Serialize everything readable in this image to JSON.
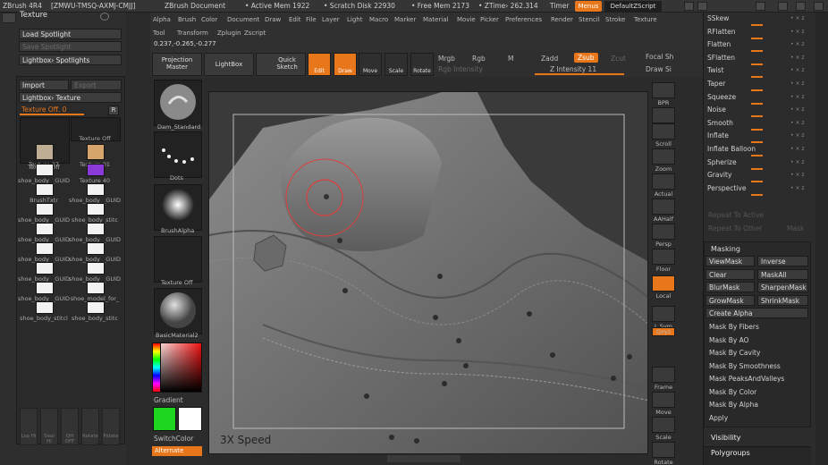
{
  "titlebar": {
    "app": "ZBrush 4R4",
    "id": "[ZMWU-TMSQ-AXMJ-CMJJ]",
    "doc": "ZBrush Document",
    "active_mem": "• Active Mem 1922",
    "scratch": "• Scratch Disk 22930",
    "free_mem": "• Free Mem 2173",
    "ztime": "• ZTime› 262.314",
    "timer": "Timer",
    "menus": "Menus",
    "default_script": "DefaultZScript"
  },
  "menubar": [
    "Alpha",
    "Brush",
    "Color",
    "Document",
    "Draw",
    "Edit",
    "File",
    "Layer",
    "Light",
    "Macro",
    "Marker",
    "Material",
    "Movie",
    "Picker",
    "Preferences",
    "Render",
    "Stencil",
    "Stroke",
    "Texture"
  ],
  "menubar2": [
    "Tool",
    "Transform",
    "Zplugin",
    "Zscript"
  ],
  "coords": "0.237,-0.265,-0.277",
  "shelf": {
    "projection_master": "Projection Master",
    "lightbox": "LightBox",
    "quick_sketch": "Quick Sketch",
    "edit": "Edit",
    "draw": "Draw",
    "move": "Move",
    "scale": "Scale",
    "rotate": "Rotate",
    "mrgb": "Mrgb",
    "rgb": "Rgb",
    "m": "M",
    "rgb_intensity": "Rgb Intensity",
    "zadd": "Zadd",
    "zsub": "Zsub",
    "zcut": "Zcut",
    "z_intensity": "Z Intensity 11",
    "focal_shift": "Focal Sh",
    "draw_size": "Draw Si"
  },
  "left": {
    "panel_title": "Texture",
    "load_spotlight": "Load Spotlight",
    "save_spotlight": "Save Spotlight",
    "lightbox_spotlights": "Lightbox› Spotlights",
    "import": "Import",
    "export": "Export",
    "lightbox_texture": "Lightbox› Texture",
    "texture_off": "Texture Off. 0",
    "r": "R",
    "thumbs": [
      [
        "Texture Off",
        "Texture Off"
      ],
      [
        "Texture 27",
        "Texture 01"
      ],
      [
        "shoe_body__GUID",
        "Texture 40"
      ],
      [
        "BrushTxtr",
        "shoe_body__GUID"
      ],
      [
        "shoe_body__GUID",
        "shoe_body_stitc"
      ],
      [
        "shoe_body__GUID",
        "shoe_body__GUID"
      ],
      [
        "shoe_body__GUID",
        "shoe_body__GUID"
      ],
      [
        "shoe_body__GUID",
        "shoe_body__GUID"
      ],
      [
        "shoe_body__GUID",
        "shoe_model_for_"
      ],
      [
        "shoe_body_stitcl",
        "shoe_body_stitc"
      ]
    ],
    "bottom_icons": [
      "Lsp Hi",
      "Seal Hi",
      "QH OFF",
      "Rotate",
      "Pstate"
    ]
  },
  "vcol": {
    "brush": "Dam_Standard",
    "stroke": "Dots",
    "alpha": "BrushAlpha",
    "texture": "Texture Off",
    "material": "BasicMaterial2",
    "gradient": "Gradient",
    "switchcolor": "SwitchColor",
    "alternate": "Alternate"
  },
  "canvas": {
    "speed_label": "3X Speed"
  },
  "nav": [
    "BPR",
    "SPix",
    "Scroll",
    "Zoom",
    "Actual",
    "AAHalf",
    "Persp",
    "Floor",
    "Local",
    "L.Sym",
    "Qxyz",
    "Frame",
    "Move",
    "Scale",
    "Rotate"
  ],
  "right": {
    "deformations": [
      "SSkew",
      "RFlatten",
      "Flatten",
      "SFlatten",
      "Twist",
      "Taper",
      "Squeeze",
      "Noise",
      "Smooth",
      "Inflate",
      "Inflate Balloon",
      "Spherize",
      "Gravity",
      "Perspective"
    ],
    "repeat_active": "Repeat To Active",
    "repeat_other": "Repeat To Other",
    "mask": "Mask",
    "masking_title": "Masking",
    "masking_buttons": [
      [
        "ViewMask",
        "Inverse"
      ],
      [
        "Clear",
        "MaskAll"
      ],
      [
        "BlurMask",
        "SharpenMask"
      ],
      [
        "GrowMask",
        "ShrinkMask"
      ]
    ],
    "create_alpha": "Create Alpha",
    "mask_items": [
      "Mask By Fibers",
      "Mask By AO",
      "Mask By Cavity",
      "Mask By Smoothness",
      "Mask PeaksAndValleys",
      "Mask By Color",
      "Mask By Alpha",
      "Apply"
    ],
    "visibility": "Visibility",
    "polygroups": "Polygroups"
  },
  "colors": {
    "accent": "#e8761b",
    "panel": "#2c2c2c",
    "canvas": "#3d3d3d"
  }
}
